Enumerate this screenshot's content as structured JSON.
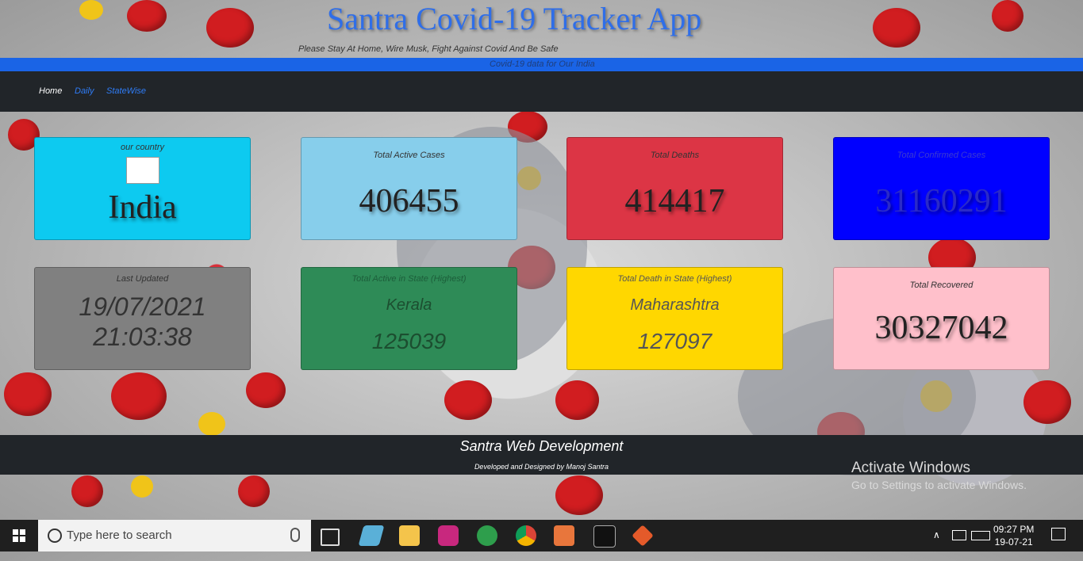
{
  "header": {
    "title": "Santra Covid-19 Tracker App",
    "tagline": "Please Stay At Home, Wire Musk, Fight Against Covid And Be Safe",
    "strip_text": "Covid-19 data for Our India"
  },
  "nav": {
    "home": "Home",
    "daily": "Daily",
    "statewise": "StateWise"
  },
  "cards": {
    "country": {
      "label": "our country",
      "value": "India"
    },
    "active": {
      "label": "Total Active Cases",
      "value": "406455"
    },
    "deaths": {
      "label": "Total Deaths",
      "value": "414417"
    },
    "confirmed": {
      "label": "Total Confirmed Cases",
      "value": "31160291"
    },
    "updated": {
      "label": "Last Updated",
      "date": "19/07/2021",
      "time": "21:03:38"
    },
    "active_state": {
      "label": "Total Active in State (Highest)",
      "state": "Kerala",
      "value": "125039"
    },
    "death_state": {
      "label": "Total Death in State (Highest)",
      "state": "Maharashtra",
      "value": "127097"
    },
    "recovered": {
      "label": "Total Recovered",
      "value": "30327042"
    }
  },
  "colors": {
    "country": "#0dcaf0",
    "active": "#87ceeb",
    "deaths": "#dc3545",
    "confirmed": "#0000ff",
    "updated": "#808080",
    "active_state": "#2e8b57",
    "death_state": "#ffd700",
    "recovered": "#ffc0cb"
  },
  "footer": {
    "title": "Santra Web Development",
    "subtitle": "Developed and Designed by Manoj Santra"
  },
  "watermark": {
    "line1": "Activate Windows",
    "line2": "Go to Settings to activate Windows."
  },
  "taskbar": {
    "search_placeholder": "Type here to search",
    "time": "09:27 PM",
    "date": "19-07-21"
  }
}
